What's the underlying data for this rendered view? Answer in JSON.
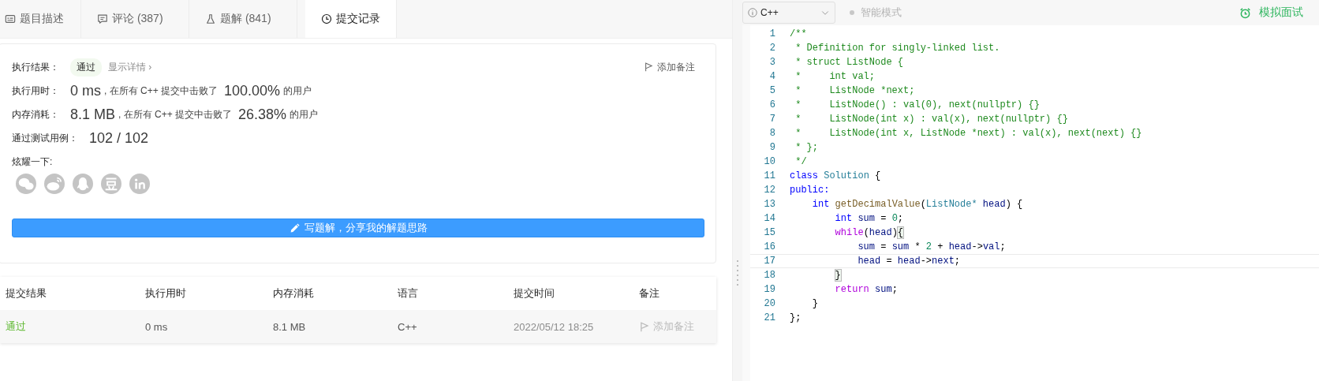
{
  "tabs": [
    {
      "kind": "description",
      "label": "题目描述",
      "selected": false
    },
    {
      "kind": "comments",
      "label": "评论 (387)",
      "selected": false
    },
    {
      "kind": "solutions",
      "label": "题解 (841)",
      "selected": false
    },
    {
      "kind": "submissions",
      "label": "提交记录",
      "selected": true
    }
  ],
  "result": {
    "label": "执行结果：",
    "passed": true,
    "status_text": "通过",
    "details_link": "显示详情 ›",
    "note_button": "添加备注"
  },
  "stats": [
    {
      "label": "执行用时：",
      "value": "0 ms",
      "middle": ", 在所有 C++ 提交中击败了",
      "percent": "100.00%",
      "suffix": "的用户"
    },
    {
      "label": "内存消耗：",
      "value": "8.1 MB",
      "middle": ", 在所有 C++ 提交中击败了",
      "percent": "26.38%",
      "suffix": "的用户"
    }
  ],
  "tests": {
    "label": "通过测试用例：",
    "value": "102 / 102"
  },
  "share": {
    "label": "炫耀一下:"
  },
  "write_button": "写题解，分享我的解题思路",
  "table": {
    "columns": [
      "提交结果",
      "执行用时",
      "内存消耗",
      "语言",
      "提交时间",
      "备注"
    ],
    "rows": [
      {
        "passed": true,
        "result": "通过",
        "runtime": "0 ms",
        "memory": "8.1 MB",
        "language": "C++",
        "time": "2022/05/12 18:25",
        "note": "添加备注",
        "note_disabled": true
      }
    ]
  },
  "editor": {
    "language": "C++",
    "mode": {
      "label": "智能模式",
      "on": false
    },
    "mock_interview": "模拟面试",
    "lines": [
      {
        "number": "1",
        "current": false,
        "tokens": [
          {
            "kind": "comment",
            "text": "/**"
          }
        ]
      },
      {
        "number": "2",
        "current": false,
        "tokens": [
          {
            "kind": "comment",
            "text": " * Definition for singly-linked list."
          }
        ]
      },
      {
        "number": "3",
        "current": false,
        "tokens": [
          {
            "kind": "comment",
            "text": " * struct ListNode {"
          }
        ]
      },
      {
        "number": "4",
        "current": false,
        "tokens": [
          {
            "kind": "comment",
            "text": " *     int val;"
          }
        ]
      },
      {
        "number": "5",
        "current": false,
        "tokens": [
          {
            "kind": "comment",
            "text": " *     ListNode *next;"
          }
        ]
      },
      {
        "number": "6",
        "current": false,
        "tokens": [
          {
            "kind": "comment",
            "text": " *     ListNode() : val(0), next(nullptr) {}"
          }
        ]
      },
      {
        "number": "7",
        "current": false,
        "tokens": [
          {
            "kind": "comment",
            "text": " *     ListNode(int x) : val(x), next(nullptr) {}"
          }
        ]
      },
      {
        "number": "8",
        "current": false,
        "tokens": [
          {
            "kind": "comment",
            "text": " *     ListNode(int x, ListNode *next) : val(x), next(next) {}"
          }
        ]
      },
      {
        "number": "9",
        "current": false,
        "tokens": [
          {
            "kind": "comment",
            "text": " * };"
          }
        ]
      },
      {
        "number": "10",
        "current": false,
        "tokens": [
          {
            "kind": "comment",
            "text": " */"
          }
        ]
      },
      {
        "number": "11",
        "current": false,
        "tokens": [
          {
            "kind": "keyword",
            "text": "class"
          },
          {
            "kind": "type",
            "text": " Solution"
          },
          {
            "kind": "plain",
            "text": " {"
          }
        ]
      },
      {
        "number": "12",
        "current": false,
        "tokens": [
          {
            "kind": "keyword",
            "text": "public:"
          }
        ]
      },
      {
        "number": "13",
        "current": false,
        "tokens": [
          {
            "kind": "keyword",
            "text": "    int"
          },
          {
            "kind": "func",
            "text": " getDecimalValue"
          },
          {
            "kind": "plain",
            "text": "("
          },
          {
            "kind": "type",
            "text": "ListNode*"
          },
          {
            "kind": "var",
            "text": " head"
          },
          {
            "kind": "plain",
            "text": ") {"
          }
        ]
      },
      {
        "number": "14",
        "current": false,
        "tokens": [
          {
            "kind": "keyword",
            "text": "        int"
          },
          {
            "kind": "var",
            "text": " sum"
          },
          {
            "kind": "plain",
            "text": " = "
          },
          {
            "kind": "number",
            "text": "0"
          },
          {
            "kind": "plain",
            "text": ";"
          }
        ]
      },
      {
        "number": "15",
        "current": false,
        "tokens": [
          {
            "kind": "control",
            "text": "        while"
          },
          {
            "kind": "plain",
            "text": "("
          },
          {
            "kind": "var",
            "text": "head"
          },
          {
            "kind": "plain",
            "text": ")"
          },
          {
            "kind": "bracket",
            "text": "{"
          }
        ]
      },
      {
        "number": "16",
        "current": false,
        "tokens": [
          {
            "kind": "var",
            "text": "            sum"
          },
          {
            "kind": "plain",
            "text": " = "
          },
          {
            "kind": "var",
            "text": "sum"
          },
          {
            "kind": "plain",
            "text": " * "
          },
          {
            "kind": "number",
            "text": "2"
          },
          {
            "kind": "plain",
            "text": " + "
          },
          {
            "kind": "var",
            "text": "head"
          },
          {
            "kind": "plain",
            "text": "->"
          },
          {
            "kind": "var",
            "text": "val"
          },
          {
            "kind": "plain",
            "text": ";"
          }
        ]
      },
      {
        "number": "17",
        "current": true,
        "tokens": [
          {
            "kind": "var",
            "text": "            head"
          },
          {
            "kind": "plain",
            "text": " = "
          },
          {
            "kind": "var",
            "text": "head"
          },
          {
            "kind": "plain",
            "text": "->"
          },
          {
            "kind": "var",
            "text": "next"
          },
          {
            "kind": "plain",
            "text": ";"
          }
        ]
      },
      {
        "number": "18",
        "current": false,
        "tokens": [
          {
            "kind": "indent",
            "text": "        }"
          }
        ]
      },
      {
        "number": "19",
        "current": false,
        "tokens": [
          {
            "kind": "control",
            "text": "        return"
          },
          {
            "kind": "var",
            "text": " sum"
          },
          {
            "kind": "plain",
            "text": ";"
          }
        ]
      },
      {
        "number": "20",
        "current": false,
        "tokens": [
          {
            "kind": "plain",
            "text": "    }"
          }
        ]
      },
      {
        "number": "21",
        "current": false,
        "tokens": [
          {
            "kind": "plain",
            "text": "};"
          }
        ]
      }
    ]
  }
}
